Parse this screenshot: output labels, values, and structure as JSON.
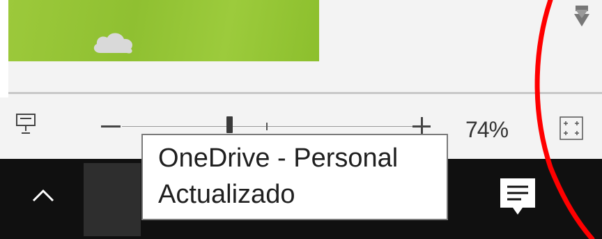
{
  "statusbar": {
    "zoom_percent": "74%",
    "zoom_slider_value": 0.36
  },
  "tooltip": {
    "line1": "OneDrive - Personal",
    "line2": "Actualizado"
  },
  "icons": {
    "presenter": "presenter-view-icon",
    "zoom_out": "minus-icon",
    "zoom_in": "plus-icon",
    "fit": "fit-to-window-icon",
    "tray": "chevron-up-icon",
    "onedrive": "cloud-icon",
    "notifications": "action-center-icon",
    "scroll": "scroll-down-icon"
  },
  "colors": {
    "slide_green": "#8fc031",
    "taskbar": "#101010",
    "annotation_red": "#ff0000"
  }
}
